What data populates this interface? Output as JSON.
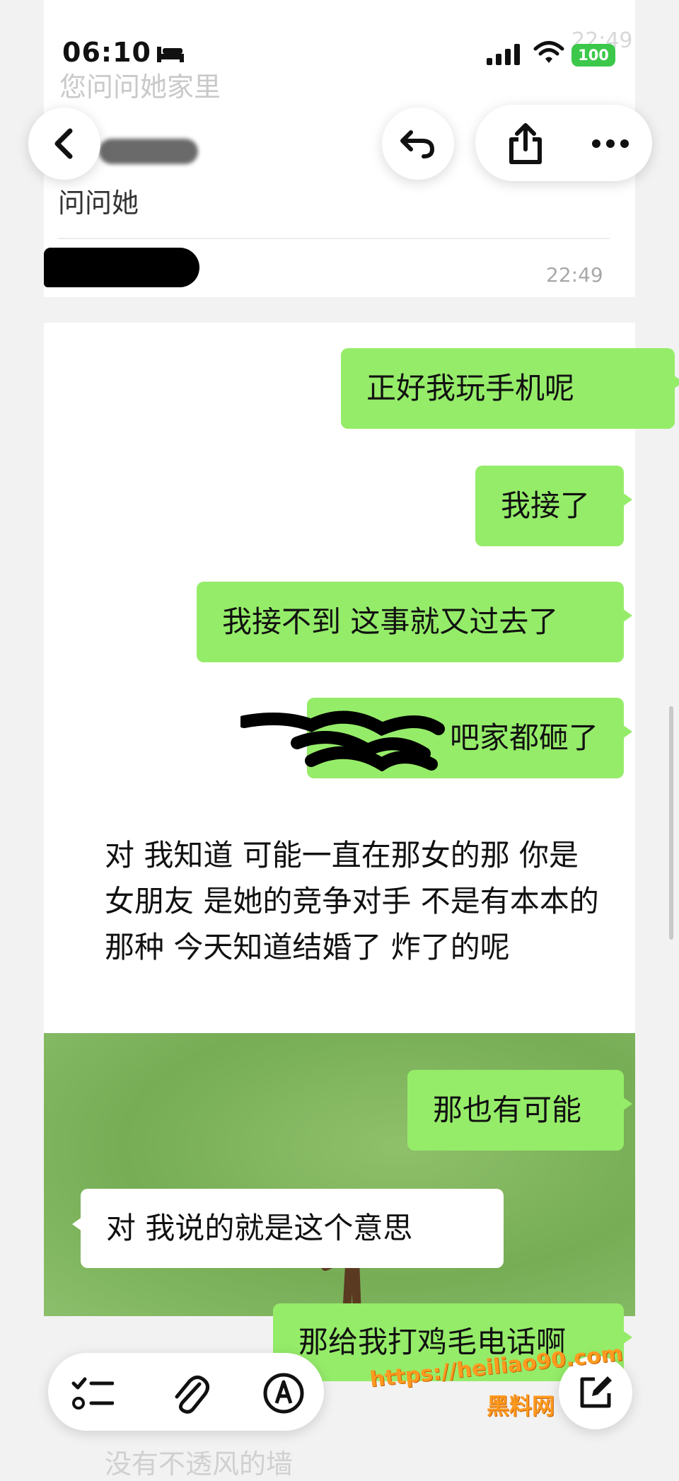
{
  "status_bar": {
    "time": "06:10",
    "ghost_time": "22:49",
    "battery": "100"
  },
  "previous": {
    "faded_line": "您问问她家里",
    "line": "问问她",
    "time": "22:49"
  },
  "messages": [
    {
      "dir": "out",
      "text": "正好我玩手机呢"
    },
    {
      "dir": "out",
      "text": "我接了"
    },
    {
      "dir": "out",
      "text": "我接不到 这事就又过去了"
    },
    {
      "dir": "out",
      "text": "吧家都砸了"
    },
    {
      "dir": "in",
      "text": "对 我知道 可能一直在那女的那 你是女朋友 是她的竞争对手 不是有本本的那种 今天知道结婚了 炸了的呢"
    },
    {
      "dir": "out",
      "text": "那也有可能"
    },
    {
      "dir": "in",
      "text": "对 我说的就是这个意思"
    },
    {
      "dir": "out",
      "text": "那给我打鸡毛电话啊"
    }
  ],
  "bottom_faded": "没有不透风的墙",
  "watermark": {
    "url": "https://heiliao90.com",
    "name": "黑料网"
  },
  "icons": {
    "back": "chevron-left-icon",
    "reply": "reply-icon",
    "share": "share-icon",
    "more": "more-icon",
    "checklist": "checklist-icon",
    "attach": "paperclip-icon",
    "markup": "pen-icon",
    "compose": "compose-icon"
  },
  "colors": {
    "out_bubble": "#95ec69",
    "in_bubble": "#ffffff",
    "battery": "#3cc84a",
    "watermark": "#ff9a1f"
  }
}
